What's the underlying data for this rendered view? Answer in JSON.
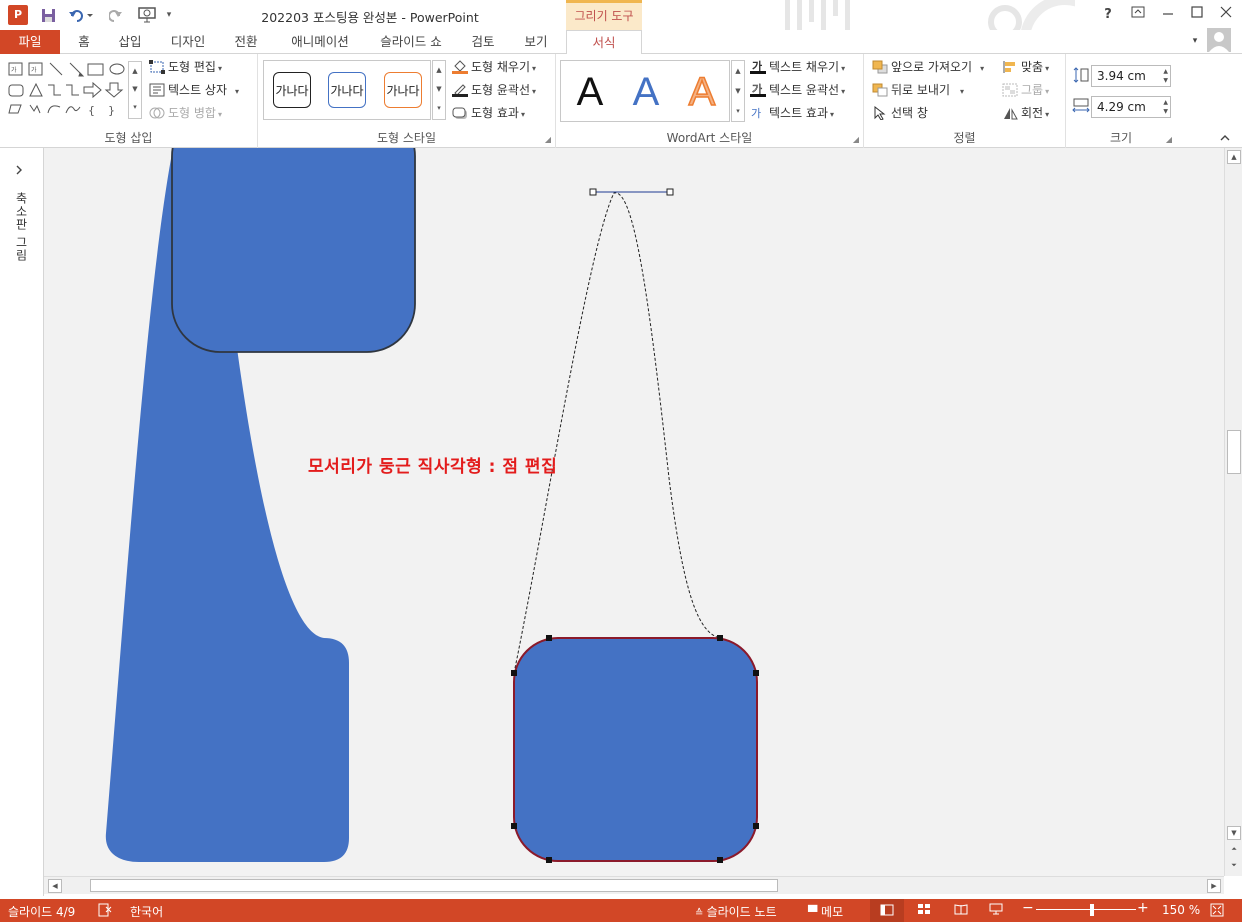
{
  "app": {
    "window_title": "202203 포스팅용 완성본 - PowerPoint",
    "contextual_tab_group": "그리기 도구",
    "help": "?"
  },
  "tabs": [
    "파일",
    "홈",
    "삽입",
    "디자인",
    "전환",
    "애니메이션",
    "슬라이드 쇼",
    "검토",
    "보기",
    "서식"
  ],
  "ribbon": {
    "insert_shapes": {
      "label": "도형 삽입",
      "edit_shape": "도형 편집",
      "text_box": "텍스트 상자",
      "merge_shapes": "도형 병합"
    },
    "shape_styles": {
      "label": "도형 스타일",
      "samples": [
        "가나다",
        "가나다",
        "가나다"
      ],
      "fill": "도형 채우기",
      "outline": "도형 윤곽선",
      "effects": "도형 효과"
    },
    "wordart": {
      "label": "WordArt 스타일",
      "samples": [
        "A",
        "A",
        "A"
      ],
      "text_fill": "텍스트 채우기",
      "text_outline": "텍스트 윤곽선",
      "text_effects": "텍스트 효과"
    },
    "arrange": {
      "label": "정렬",
      "bring_forward": "앞으로 가져오기",
      "send_backward": "뒤로 보내기",
      "selection_pane": "선택 창",
      "align": "맞춤",
      "group": "그룹",
      "rotate": "회전"
    },
    "size": {
      "label": "크기",
      "height": "3.94 cm",
      "width": "4.29 cm"
    }
  },
  "left_pane": {
    "label": "축소판 그림"
  },
  "slide": {
    "caption": "모서리가 둥근 직사각형 : 점 편집",
    "shape_fill": "#4472c4",
    "shape_outline_selected": "#8b1a2b"
  },
  "status": {
    "slide_position": "슬라이드 4/9",
    "language": "한국어",
    "notes": "슬라이드 노트",
    "comments": "메모",
    "zoom": "150 %"
  },
  "colors": {
    "accent": "#d24726",
    "caption_red": "#e31c1c"
  }
}
